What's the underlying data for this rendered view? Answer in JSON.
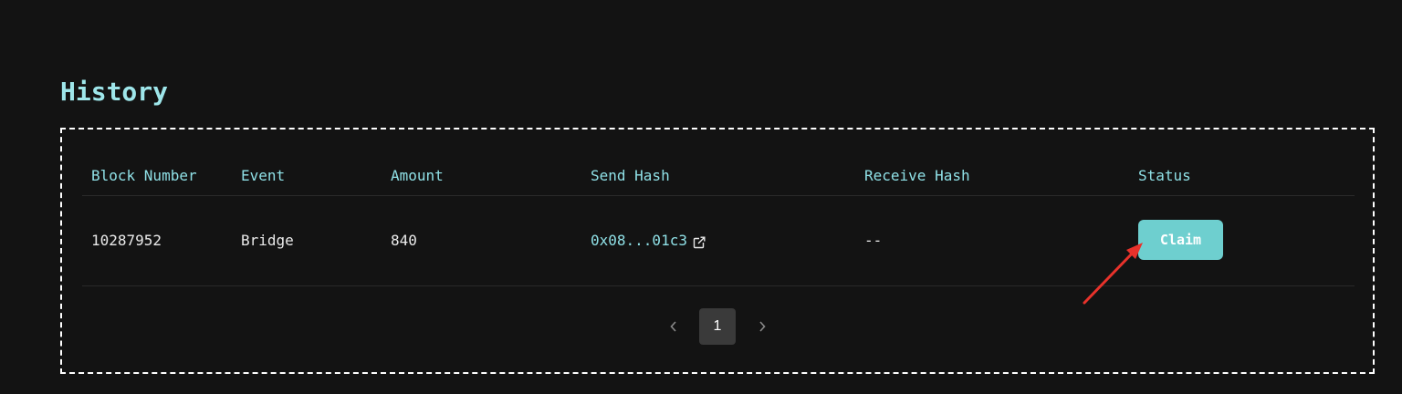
{
  "page": {
    "title": "History"
  },
  "table": {
    "columns": [
      "Block Number",
      "Event",
      "Amount",
      "Send Hash",
      "Receive Hash",
      "Status"
    ],
    "rows": [
      {
        "block_number": "10287952",
        "event": "Bridge",
        "amount": "840",
        "send_hash": "0x08...01c3",
        "receive_hash": "--",
        "status_action": "Claim"
      }
    ]
  },
  "pagination": {
    "current_page": "1",
    "prev_icon": "chevron-left-icon",
    "next_icon": "chevron-right-icon"
  },
  "icons": {
    "send_hash_link": "external-link-icon"
  },
  "colors": {
    "background": "#131313",
    "accent": "#9ee6ea",
    "claim_button": "#6ecfcf",
    "page_active": "#3a3a3a",
    "annotation_arrow": "#e8322b"
  }
}
